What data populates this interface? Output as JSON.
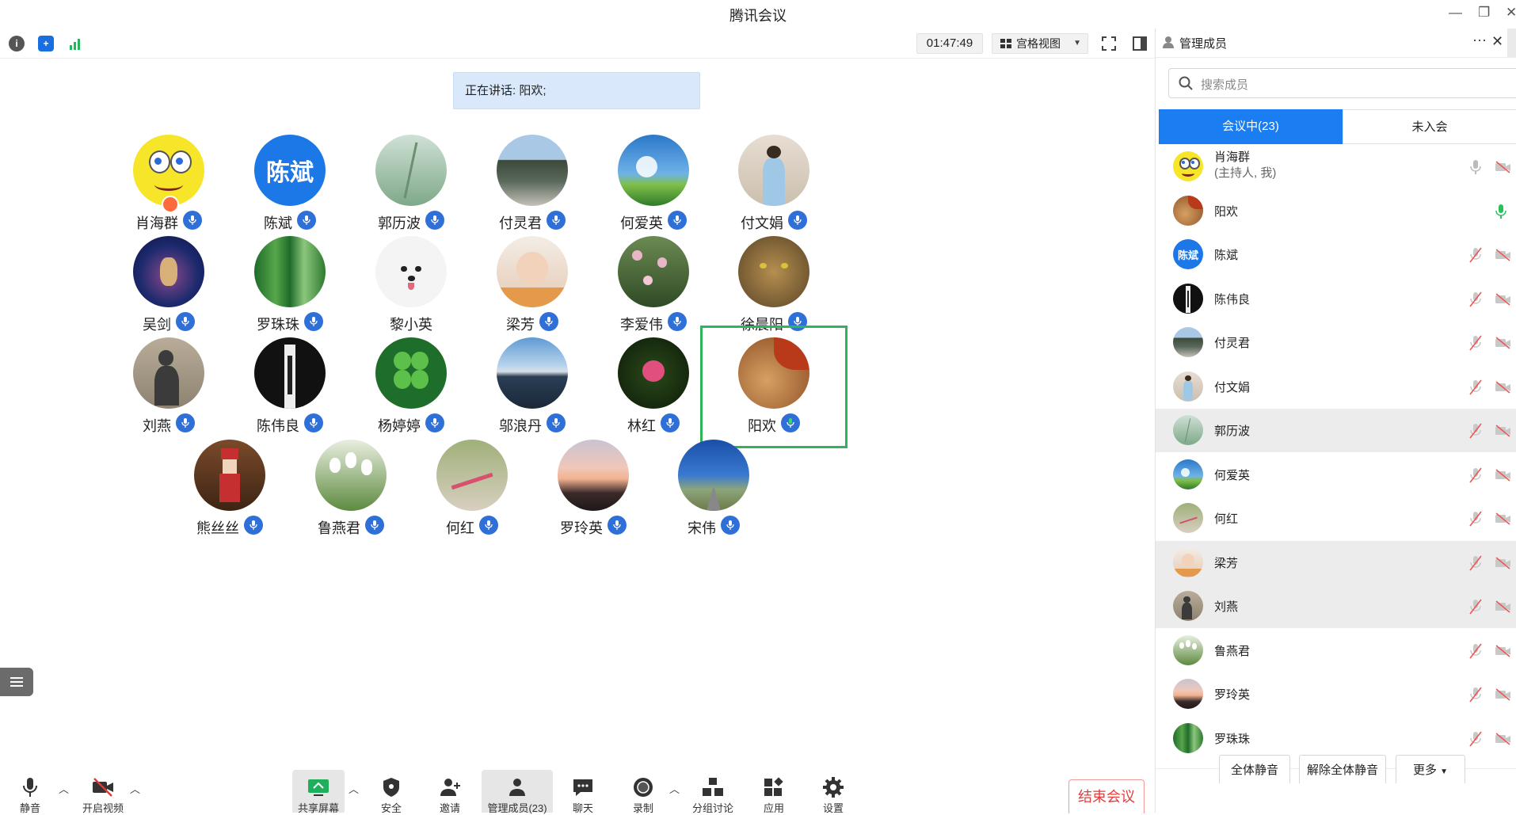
{
  "window": {
    "title": "腾讯会议"
  },
  "toolbar": {
    "timer": "01:47:49",
    "view_label": "宫格视图"
  },
  "speaking": {
    "text": "正在讲话: 阳欢;"
  },
  "participants": [
    {
      "name": "肖海群",
      "avatar": "spongebob",
      "host": true
    },
    {
      "name": "陈斌",
      "avatar": "text",
      "avatar_text": "陈斌"
    },
    {
      "name": "郭历波",
      "avatar": "grass"
    },
    {
      "name": "付灵君",
      "avatar": "village"
    },
    {
      "name": "何爱英",
      "avatar": "dandelion"
    },
    {
      "name": "付文娟",
      "avatar": "woman"
    },
    {
      "name": "吴剑",
      "avatar": "fantasy"
    },
    {
      "name": "罗珠珠",
      "avatar": "bamboo"
    },
    {
      "name": "黎小英",
      "avatar": "dog",
      "no_mic": true
    },
    {
      "name": "梁芳",
      "avatar": "baby"
    },
    {
      "name": "李爱伟",
      "avatar": "flowers"
    },
    {
      "name": "徐晨阳",
      "avatar": "leopard"
    },
    {
      "name": "刘燕",
      "avatar": "shadow"
    },
    {
      "name": "陈伟良",
      "avatar": "suit"
    },
    {
      "name": "杨婷婷",
      "avatar": "clover"
    },
    {
      "name": "邬浪丹",
      "avatar": "lake"
    },
    {
      "name": "林红",
      "avatar": "rose"
    },
    {
      "name": "阳欢",
      "avatar": "lion",
      "active": true
    },
    {
      "name": "熊丝丝",
      "avatar": "nutcracker"
    },
    {
      "name": "鲁燕君",
      "avatar": "tulips"
    },
    {
      "name": "何红",
      "avatar": "dragonfly"
    },
    {
      "name": "罗玲英",
      "avatar": "sunset"
    },
    {
      "name": "宋伟",
      "avatar": "road"
    }
  ],
  "bottom_bar": {
    "mute_label": "静音",
    "video_label": "开启视频",
    "share_label": "共享屏幕",
    "security_label": "安全",
    "invite_label": "邀请",
    "members_label": "管理成员(23)",
    "chat_label": "聊天",
    "record_label": "录制",
    "breakout_label": "分组讨论",
    "apps_label": "应用",
    "settings_label": "设置",
    "end_label": "结束会议"
  },
  "panel": {
    "title": "管理成员",
    "search_placeholder": "搜索成员",
    "tab_in_meeting": "会议中(23)",
    "tab_not_joined": "未入会",
    "members": [
      {
        "name": "肖海群",
        "sub": "(主持人, 我)",
        "avatar": "spongebob",
        "mic": "off-gray",
        "video": "off"
      },
      {
        "name": "阳欢",
        "avatar": "lion",
        "mic": "on-green"
      },
      {
        "name": "陈斌",
        "avatar": "text",
        "avatar_text": "陈斌",
        "mic": "muted",
        "video": "off"
      },
      {
        "name": "陈伟良",
        "avatar": "suit",
        "mic": "muted",
        "video": "off"
      },
      {
        "name": "付灵君",
        "avatar": "village",
        "mic": "muted",
        "video": "off"
      },
      {
        "name": "付文娟",
        "avatar": "woman",
        "mic": "muted",
        "video": "off"
      },
      {
        "name": "郭历波",
        "avatar": "grass",
        "mic": "muted",
        "video": "off",
        "highlight": true
      },
      {
        "name": "何爱英",
        "avatar": "dandelion",
        "mic": "muted",
        "video": "off"
      },
      {
        "name": "何红",
        "avatar": "dragonfly",
        "mic": "muted",
        "video": "off"
      },
      {
        "name": "梁芳",
        "avatar": "baby",
        "mic": "muted",
        "video": "off",
        "highlight": true
      },
      {
        "name": "刘燕",
        "avatar": "shadow",
        "mic": "muted",
        "video": "off",
        "highlight": true
      },
      {
        "name": "鲁燕君",
        "avatar": "tulips",
        "mic": "muted",
        "video": "off"
      },
      {
        "name": "罗玲英",
        "avatar": "sunset",
        "mic": "muted",
        "video": "off"
      },
      {
        "name": "罗珠珠",
        "avatar": "bamboo",
        "mic": "muted",
        "video": "off"
      }
    ],
    "mute_all": "全体静音",
    "unmute_all": "解除全体静音",
    "more": "更多"
  }
}
